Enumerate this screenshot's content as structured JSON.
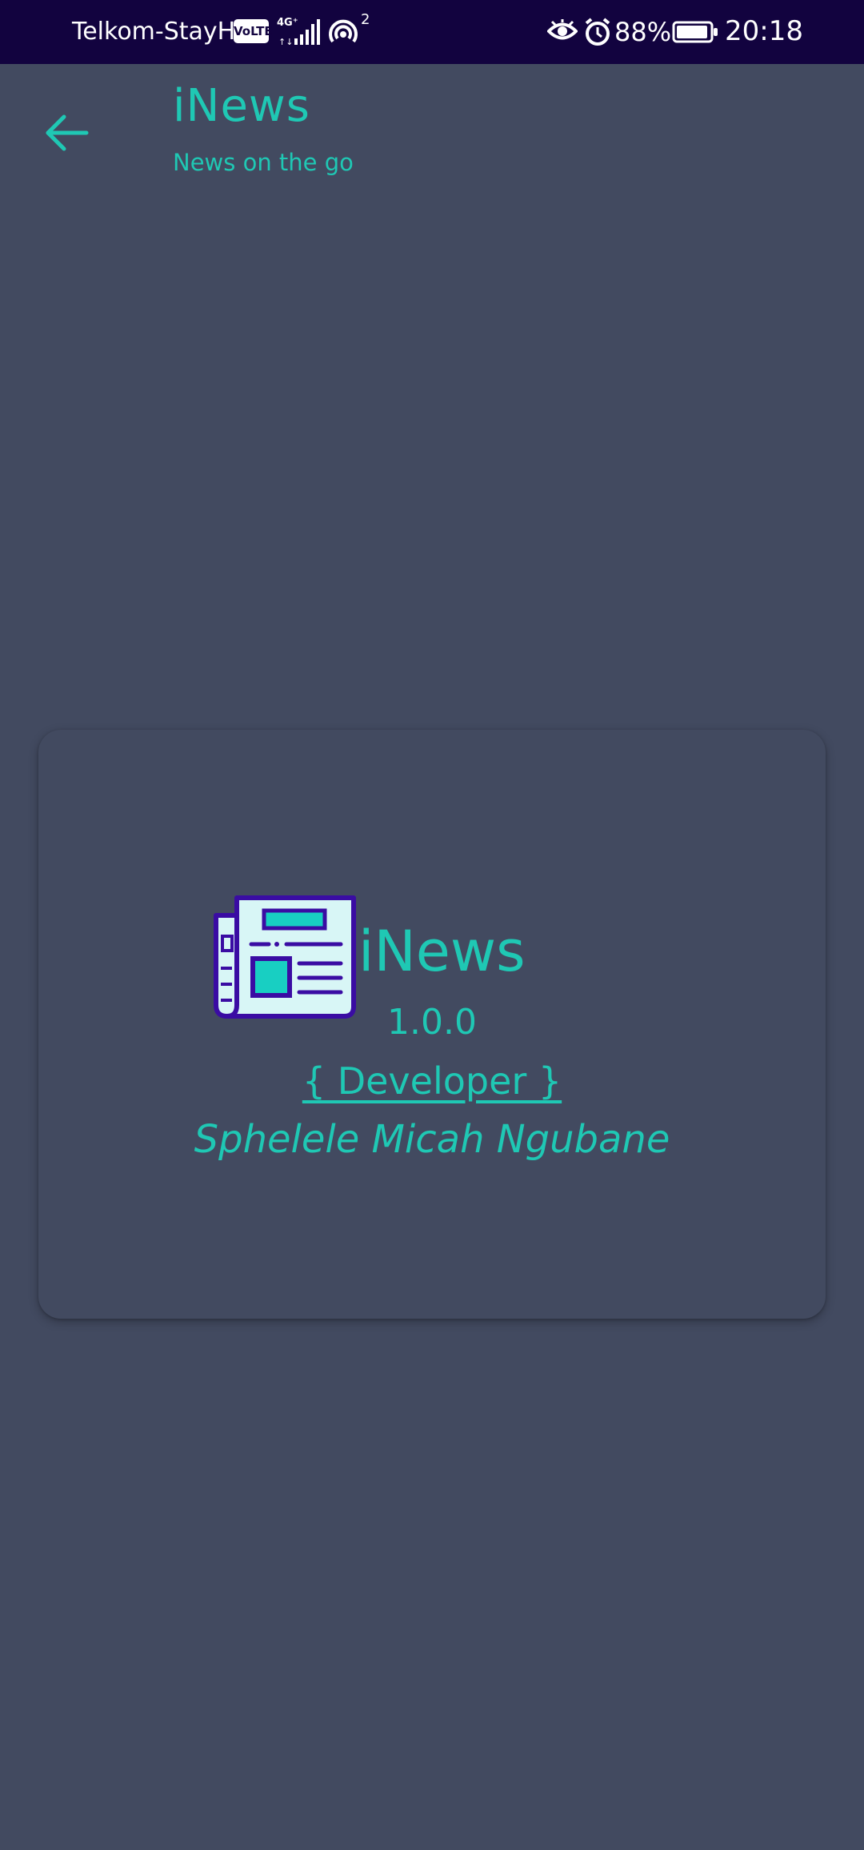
{
  "status_bar": {
    "carrier": "Telkom-StayH...",
    "volte": "VoLTE",
    "network_type": "4G+",
    "hotspot_count": "2",
    "battery_percent": "88%",
    "time": "20:18"
  },
  "app_bar": {
    "title": "iNews",
    "subtitle": "News on the go"
  },
  "about_card": {
    "app_name": "iNews",
    "version": "1.0.0",
    "developer_label": "{ Developer }",
    "developer_name": "Sphelele Micah Ngubane"
  },
  "colors": {
    "background": "#424a60",
    "status_bar": "#12033f",
    "accent": "#1fc8b4",
    "logo_outline": "#3a0ca3",
    "logo_paper": "#d8f6f6"
  }
}
